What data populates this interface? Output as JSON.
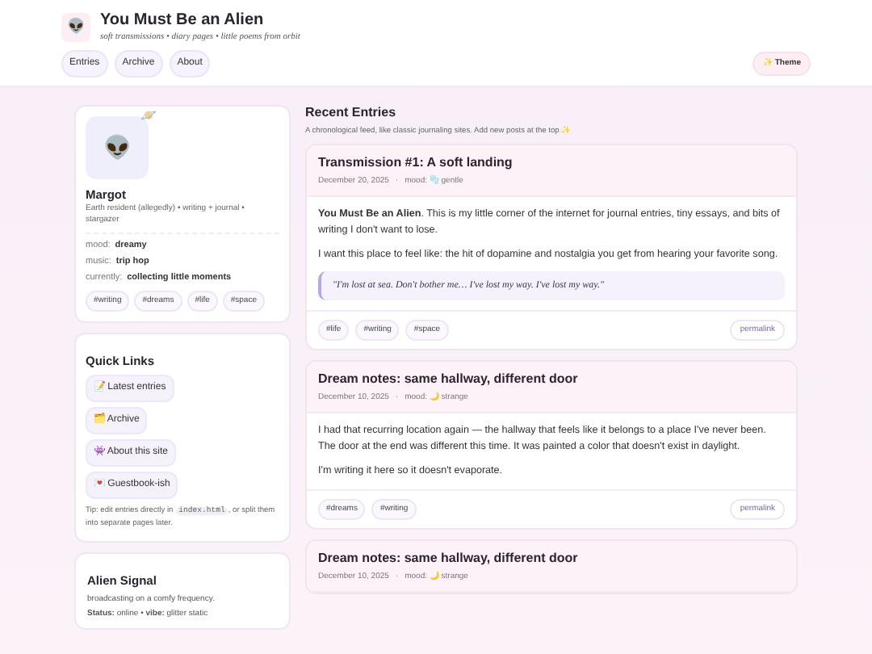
{
  "site": {
    "logo": "👽",
    "title": "You Must Be an Alien",
    "tagline": "soft transmissions • diary pages • little poems from orbit"
  },
  "nav": [
    {
      "label": "Entries"
    },
    {
      "label": "Archive"
    },
    {
      "label": "About"
    }
  ],
  "theme_button": "✨ Theme",
  "profile": {
    "avatar": "👽",
    "badge": "🪐",
    "name": "Margot",
    "bio": "Earth resident (allegedly) • writing + journal • stargazer",
    "facts": [
      {
        "label": "mood:",
        "value": "dreamy"
      },
      {
        "label": "music:",
        "value": "trip hop"
      },
      {
        "label": "currently:",
        "value": "collecting little moments"
      }
    ],
    "tags": [
      "#writing",
      "#dreams",
      "#life",
      "#space"
    ]
  },
  "quick_links": {
    "title": "Quick Links",
    "links": [
      "📝 Latest entries",
      "🗂️ Archive",
      "👾 About this site",
      "💌 Guestbook-ish"
    ],
    "tip_before": "Tip: edit entries directly in",
    "tip_code": "index.html",
    "tip_after": ", or split them into separate pages later."
  },
  "signal": {
    "title": "Alien Signal",
    "lines": [
      "broadcasting on a comfy frequency.",
      "**Status:** online • **vibe:** glitter static"
    ]
  },
  "feed": {
    "meta_separator": "·",
    "title": "Recent Entries",
    "subtitle": "A chronological feed, like classic journaling sites. Add new posts at the top ✨"
  },
  "entries": [
    {
      "title": "Transmission #1: A soft landing",
      "date": "December 20, 2025",
      "mood": "mood: 🫧 gentle",
      "paragraphs": [
        "**You Must Be an Alien**. This is my little corner of the internet for journal entries, tiny essays, and bits of writing I don't want to lose.",
        "I want this place to feel like: the hit of dopamine and nostalgia you get from hearing your favorite song."
      ],
      "quote": "\"I'm lost at sea. Don't bother me… I've lost my way. I've lost my way.\"",
      "tags": [
        "#life",
        "#writing",
        "#space"
      ],
      "permalink": "permalink"
    },
    {
      "title": "Dream notes: same hallway, different door",
      "date": "December 10, 2025",
      "mood": "mood: 🌙 strange",
      "paragraphs": [
        "I had that recurring location again — the hallway that feels like it belongs to a place I've never been. The door at the end was different this time. It was painted a color that doesn't exist in daylight.",
        "I'm writing it here so it doesn't evaporate."
      ],
      "tags": [
        "#dreams",
        "#writing"
      ],
      "permalink": "permalink"
    },
    {
      "title": "Dream notes: same hallway, different door",
      "date": "December 10, 2025",
      "mood": "mood: 🌙 strange"
    }
  ]
}
